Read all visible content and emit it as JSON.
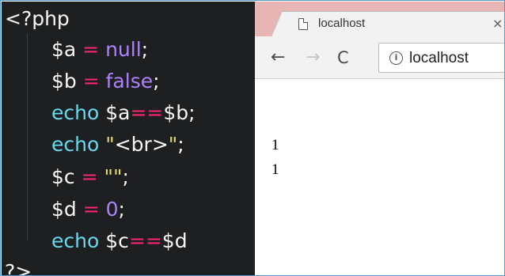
{
  "editor": {
    "lines": [
      {
        "tokens": [
          {
            "t": "<?php",
            "k": "tag"
          }
        ]
      },
      {
        "tokens": [
          {
            "t": "$a",
            "k": "var"
          },
          {
            "t": " = ",
            "k": "op"
          },
          {
            "t": "null",
            "k": "bool"
          },
          {
            "t": ";",
            "k": "pun"
          }
        ]
      },
      {
        "tokens": [
          {
            "t": "$b",
            "k": "var"
          },
          {
            "t": " = ",
            "k": "op"
          },
          {
            "t": "false",
            "k": "bool"
          },
          {
            "t": ";",
            "k": "pun"
          }
        ]
      },
      {
        "tokens": [
          {
            "t": "echo",
            "k": "kw"
          },
          {
            "t": " $a",
            "k": "var"
          },
          {
            "t": "==",
            "k": "op"
          },
          {
            "t": "$b",
            "k": "var"
          },
          {
            "t": ";",
            "k": "pun"
          }
        ]
      },
      {
        "tokens": [
          {
            "t": "echo",
            "k": "kw"
          },
          {
            "t": " \"",
            "k": "str"
          },
          {
            "t": "<br>",
            "k": "html"
          },
          {
            "t": "\"",
            "k": "str"
          },
          {
            "t": ";",
            "k": "pun"
          }
        ]
      },
      {
        "tokens": [
          {
            "t": "$c",
            "k": "var"
          },
          {
            "t": " = ",
            "k": "op"
          },
          {
            "t": "\"\"",
            "k": "str"
          },
          {
            "t": ";",
            "k": "pun"
          }
        ]
      },
      {
        "tokens": [
          {
            "t": "$d",
            "k": "var"
          },
          {
            "t": " = ",
            "k": "op"
          },
          {
            "t": "0",
            "k": "bool"
          },
          {
            "t": ";",
            "k": "pun"
          }
        ]
      },
      {
        "tokens": [
          {
            "t": "echo",
            "k": "kw"
          },
          {
            "t": " $c",
            "k": "var"
          },
          {
            "t": "==",
            "k": "op"
          },
          {
            "t": "$d",
            "k": "var"
          }
        ]
      },
      {
        "tokens": [
          {
            "t": "?>",
            "k": "tag"
          }
        ]
      }
    ],
    "colors": {
      "background": "#1e1f21",
      "keyword": "#66d9ef",
      "operator": "#f92672",
      "constant": "#ae81ff",
      "string": "#e6db74",
      "text": "#f8f8f2"
    }
  },
  "browser": {
    "tab": {
      "title": "localhost",
      "icon": "page-icon",
      "close_label": "×"
    },
    "toolbar": {
      "back_label": "←",
      "forward_label": "→",
      "reload_label": "C",
      "info_label": "i",
      "url": "localhost"
    },
    "page": {
      "output_lines": [
        "1",
        "1"
      ]
    },
    "colors": {
      "tabstrip": "#e8b5b5",
      "toolbar": "#f2f2f2"
    }
  }
}
